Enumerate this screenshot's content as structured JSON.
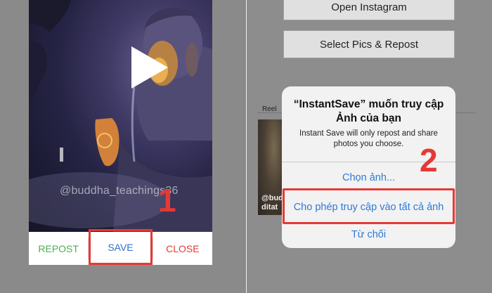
{
  "left": {
    "watermark": "@buddha_teachings36",
    "actions": {
      "repost": "REPOST",
      "save": "SAVE",
      "close": "CLOSE"
    },
    "step_label": "1"
  },
  "right": {
    "buttons": {
      "open_instagram": "Open Instagram",
      "select_pics": "Select Pics & Repost"
    },
    "reel_label": "Reel",
    "reel_thumb_text_line1": "@bud",
    "reel_thumb_text_line2": "ditat",
    "step_label": "2"
  },
  "dialog": {
    "title": "“InstantSave” muốn truy cập Ảnh của bạn",
    "message": "Instant Save will only repost and share photos you choose.",
    "choose_photos": "Chọn ảnh...",
    "allow_all": "Cho phép truy cập vào tất cả ảnh",
    "deny": "Từ chối"
  },
  "colors": {
    "highlight": "#e53935",
    "link_blue": "#2d7ad6",
    "repost_green": "#4caf50",
    "close_red": "#e53935"
  },
  "icons": [
    "play-icon"
  ]
}
